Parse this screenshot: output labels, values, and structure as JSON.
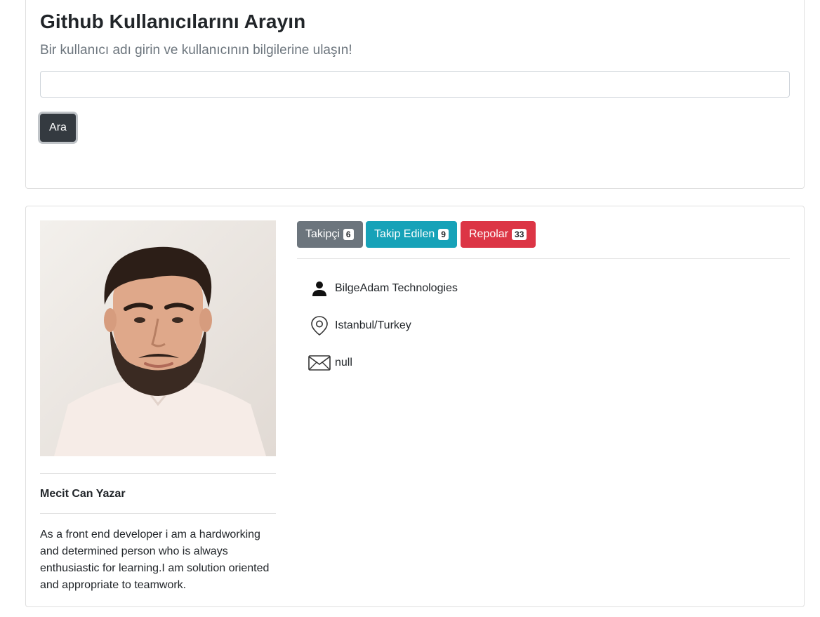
{
  "search": {
    "title": "Github Kullanıcılarını Arayın",
    "subtitle": "Bir kullanıcı adı girin ve kullanıcının bilgilerine ulaşın!",
    "input_value": "",
    "input_placeholder": "",
    "button_label": "Ara"
  },
  "profile": {
    "name": "Mecit Can Yazar",
    "bio": "As a front end developer i am a hardworking and determined person who is always enthusiastic for learning.I am solution oriented and appropriate to teamwork.",
    "stats": {
      "followers": {
        "label": "Takipçi",
        "count": "6",
        "color": "#6c757d"
      },
      "following": {
        "label": "Takip Edilen",
        "count": "9",
        "color": "#17a2b8"
      },
      "repos": {
        "label": "Repolar",
        "count": "33",
        "color": "#dc3545"
      }
    },
    "info": {
      "company": {
        "icon": "person-icon",
        "value": "BilgeAdam Technologies"
      },
      "location": {
        "icon": "location-pin-icon",
        "value": "Istanbul/Turkey"
      },
      "email": {
        "icon": "envelope-icon",
        "value": "null"
      }
    }
  }
}
